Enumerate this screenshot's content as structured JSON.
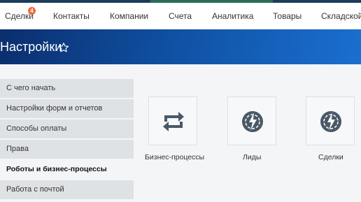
{
  "top_nav": {
    "items": [
      {
        "label": "Сделки",
        "badge": "4"
      },
      {
        "label": "Контакты"
      },
      {
        "label": "Компании"
      },
      {
        "label": "Счета"
      },
      {
        "label": "Аналитика"
      },
      {
        "label": "Товары"
      },
      {
        "label": "Складской у"
      }
    ]
  },
  "header": {
    "title": "Настройки",
    "star_icon": "star-outline-icon"
  },
  "sidebar": {
    "items": [
      {
        "label": "С чего начать"
      },
      {
        "label": "Настройки форм и отчетов"
      },
      {
        "label": "Способы оплаты"
      },
      {
        "label": "Права"
      },
      {
        "label": "Роботы и бизнес-процессы",
        "active": true
      },
      {
        "label": "Работа с почтой"
      }
    ]
  },
  "tiles": [
    {
      "label": "Бизнес-процессы",
      "icon": "refresh-arrows-icon"
    },
    {
      "label": "Лиды",
      "icon": "robot-gear-lightning-icon"
    },
    {
      "label": "Сделки",
      "icon": "robot-gear-lightning-icon"
    }
  ],
  "colors": {
    "accent_blue": "#0f4fa0",
    "badge": "#ef6a3c",
    "icon_dark": "#4a5866",
    "sidebar_bg": "#dfe2e5"
  }
}
